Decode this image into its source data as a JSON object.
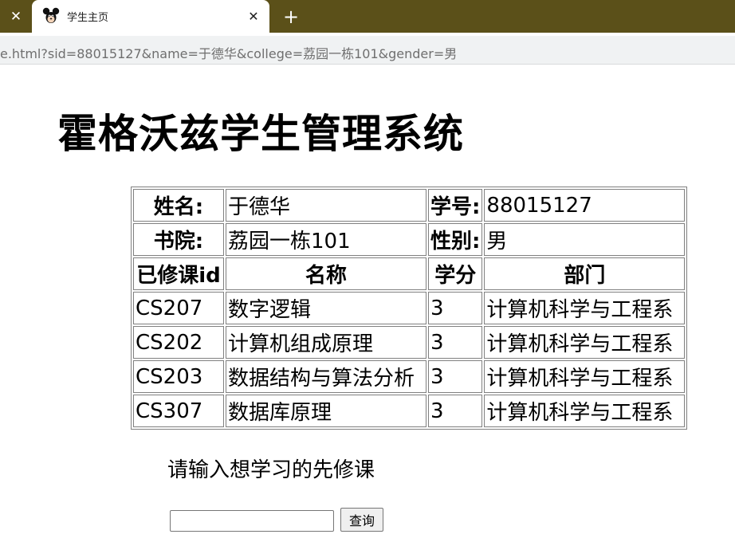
{
  "browser": {
    "tab_title": "学生主页",
    "url": "e.html?sid=88015127&name=于德华&college=荔园一栋101&gender=男",
    "accent_color": "#5b5019"
  },
  "page": {
    "title": "霍格沃兹学生管理系统"
  },
  "student": {
    "name_label": "姓名:",
    "name": "于德华",
    "sid_label": "学号:",
    "sid": "88015127",
    "college_label": "书院:",
    "college": "荔园一栋101",
    "gender_label": "性别:",
    "gender": "男"
  },
  "courses": {
    "headers": [
      "已修课id",
      "名称",
      "学分",
      "部门"
    ],
    "rows": [
      [
        "CS207",
        "数字逻辑",
        "3",
        "计算机科学与工程系"
      ],
      [
        "CS202",
        "计算机组成原理",
        "3",
        "计算机科学与工程系"
      ],
      [
        "CS203",
        "数据结构与算法分析",
        "3",
        "计算机科学与工程系"
      ],
      [
        "CS307",
        "数据库原理",
        "3",
        "计算机科学与工程系"
      ]
    ]
  },
  "query": {
    "prompt": "请输入想学习的先修课",
    "input_value": "",
    "button_label": "查询"
  }
}
